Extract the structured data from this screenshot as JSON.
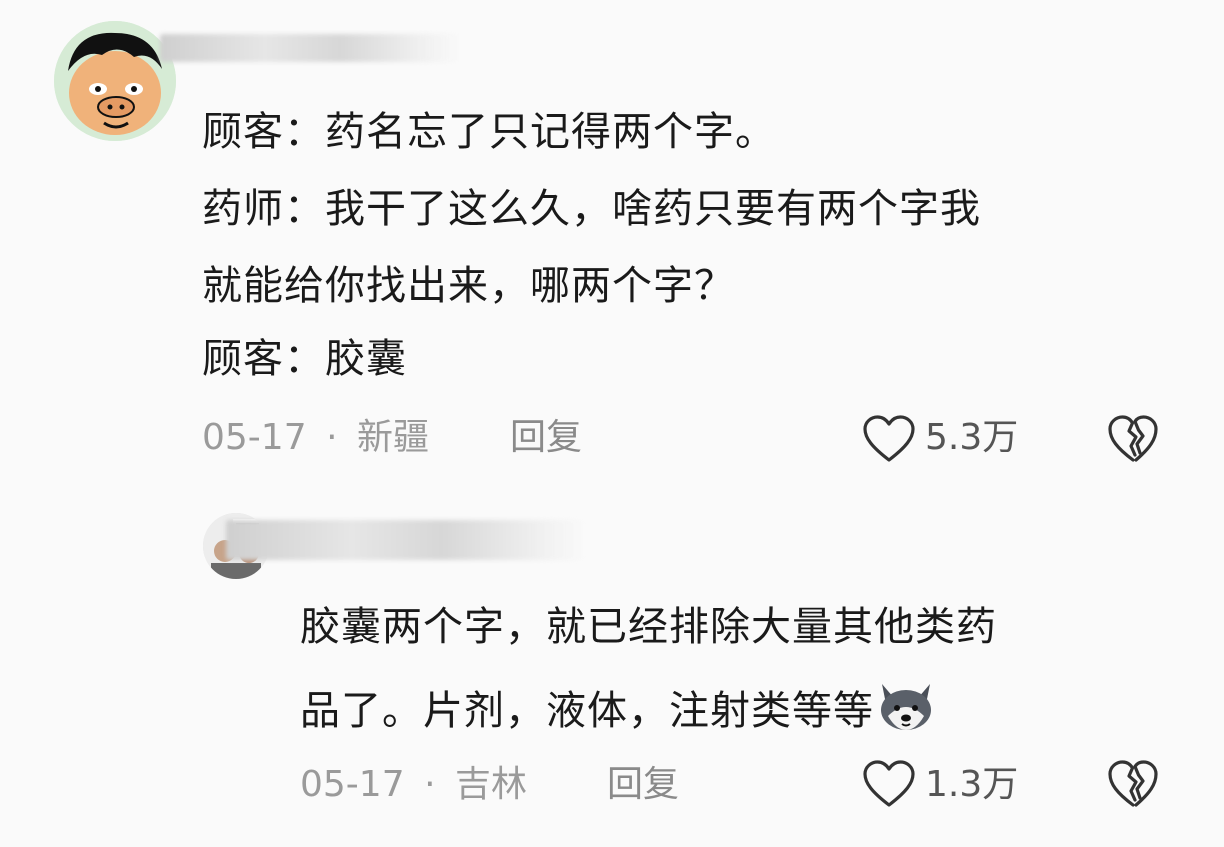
{
  "comment": {
    "lines": [
      "顾客：药名忘了只记得两个字。",
      "药师：我干了这么久，啥药只要有两个字我",
      "就能给你找出来，哪两个字？",
      "顾客：胶囊"
    ],
    "date": "05-17",
    "separator": "·",
    "location": "新疆",
    "reply_label": "回复",
    "likes": "5.3万"
  },
  "reply": {
    "lines": [
      "胶囊两个字，就已经排除大量其他类药",
      "品了。片剂，液体，注射类等等"
    ],
    "date": "05-17",
    "separator": "·",
    "location": "吉林",
    "reply_label": "回复",
    "likes": "1.3万"
  },
  "icons": {
    "like": "heart-outline-icon",
    "dislike": "broken-heart-icon",
    "emoji": "dog-face-emoji-icon"
  },
  "colors": {
    "background": "#fafafa",
    "text": "#1a1a1a",
    "meta": "#9a9a9a"
  }
}
